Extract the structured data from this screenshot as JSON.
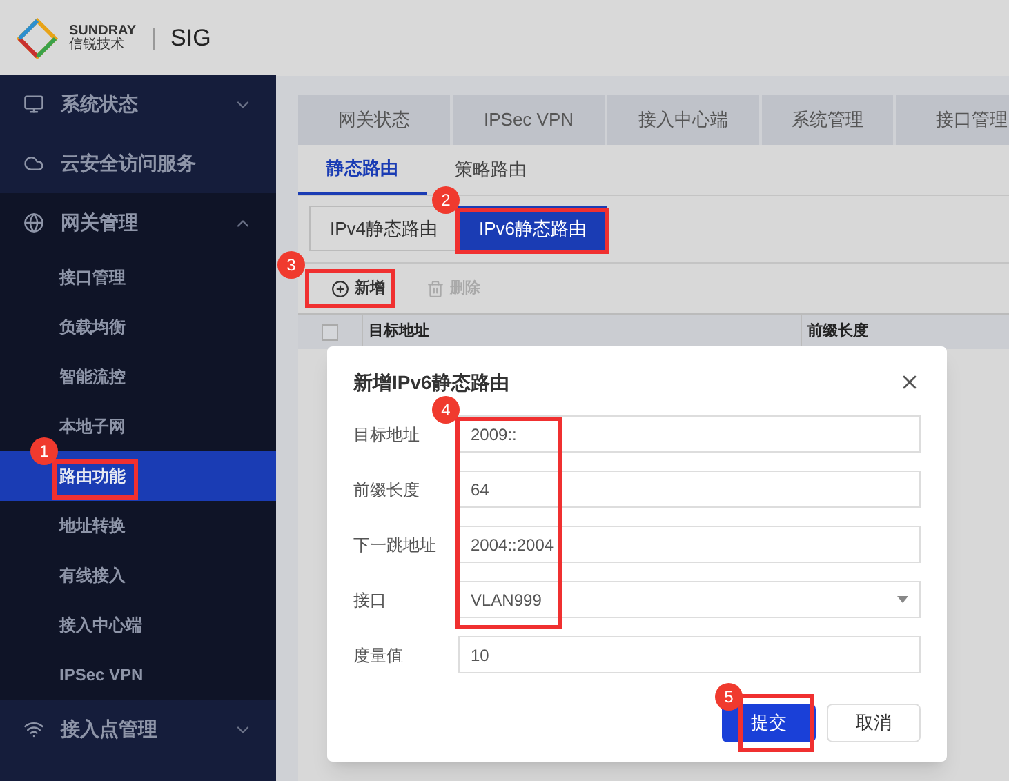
{
  "header": {
    "brand_top": "SUNDRAY",
    "brand_bottom": "信锐技术",
    "product": "SIG"
  },
  "sidebar": {
    "items": [
      {
        "label": "系统状态",
        "expanded": false
      },
      {
        "label": "云安全访问服务"
      },
      {
        "label": "网关管理",
        "expanded": true,
        "children": [
          {
            "label": "接口管理",
            "selected": false
          },
          {
            "label": "负载均衡",
            "selected": false
          },
          {
            "label": "智能流控",
            "selected": false
          },
          {
            "label": "本地子网",
            "selected": false
          },
          {
            "label": "路由功能",
            "selected": true
          },
          {
            "label": "地址转换",
            "selected": false
          },
          {
            "label": "有线接入",
            "selected": false
          },
          {
            "label": "接入中心端",
            "selected": false
          },
          {
            "label": "IPSec VPN",
            "selected": false
          }
        ]
      },
      {
        "label": "接入点管理",
        "expanded": false
      }
    ]
  },
  "top_tabs": [
    {
      "label": "网关状态",
      "selected": false
    },
    {
      "label": "IPSec VPN",
      "selected": false
    },
    {
      "label": "接入中心端",
      "selected": false
    },
    {
      "label": "系统管理",
      "selected": false
    },
    {
      "label": "接口管理",
      "selected": false
    }
  ],
  "sub_tabs": [
    {
      "label": "静态路由",
      "selected": true
    },
    {
      "label": "策略路由",
      "selected": false
    }
  ],
  "segments": [
    {
      "label": "IPv4静态路由",
      "selected": false
    },
    {
      "label": "IPv6静态路由",
      "selected": true
    }
  ],
  "toolbar": [
    {
      "label": "新增",
      "kind": "add",
      "disabled": false
    },
    {
      "label": "删除",
      "kind": "delete",
      "disabled": true
    }
  ],
  "table": {
    "select_all_checked": false,
    "columns": [
      "目标地址",
      "前缀长度"
    ]
  },
  "dialog": {
    "title": "新增IPv6静态路由",
    "fields": [
      {
        "label": "目标地址",
        "value": "2009::",
        "kind": "text"
      },
      {
        "label": "前缀长度",
        "value": "64",
        "kind": "text"
      },
      {
        "label": "下一跳地址",
        "value": "2004::2004",
        "kind": "text"
      },
      {
        "label": "接口",
        "value": "VLAN999",
        "kind": "select"
      },
      {
        "label": "度量值",
        "value": "10",
        "kind": "text"
      }
    ],
    "buttons": [
      {
        "label": "提交",
        "kind": "primary"
      },
      {
        "label": "取消",
        "kind": "secondary"
      }
    ]
  },
  "annotations": [
    {
      "number": "1"
    },
    {
      "number": "2"
    },
    {
      "number": "3"
    },
    {
      "number": "4"
    },
    {
      "number": "5"
    }
  ]
}
